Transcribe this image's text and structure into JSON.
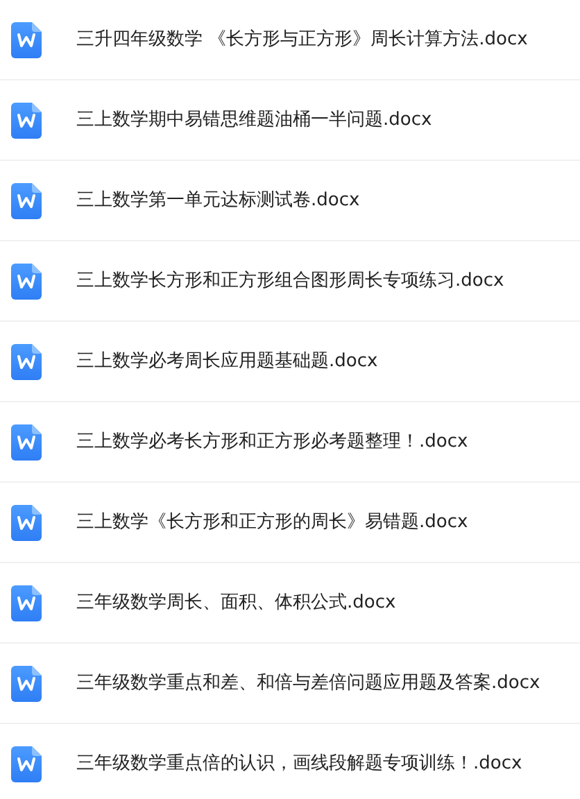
{
  "files": [
    {
      "name": "三升四年级数学 《长方形与正方形》周长计算方法.docx"
    },
    {
      "name": "三上数学期中易错思维题油桶一半问题.docx"
    },
    {
      "name": "三上数学第一单元达标测试卷.docx"
    },
    {
      "name": "三上数学长方形和正方形组合图形周长专项练习.docx"
    },
    {
      "name": "三上数学必考周长应用题基础题.docx"
    },
    {
      "name": "三上数学必考长方形和正方形必考题整理！.docx"
    },
    {
      "name": "三上数学《长方形和正方形的周长》易错题.docx"
    },
    {
      "name": "三年级数学周长、面积、体积公式.docx"
    },
    {
      "name": "三年级数学重点和差、和倍与差倍问题应用题及答案.docx"
    },
    {
      "name": "三年级数学重点倍的认识，画线段解题专项训练！.docx"
    }
  ]
}
